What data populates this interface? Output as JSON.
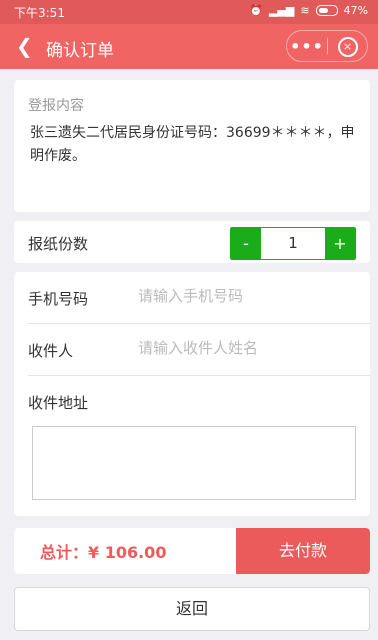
{
  "status_bar": {
    "time": "下午3:51",
    "battery": "47%"
  },
  "nav": {
    "title": "确认订单",
    "more_label": "•••",
    "close_label": "×"
  },
  "content": {
    "label": "登报内容",
    "text": "张三遗失二代居民身份证号码：36699＊＊＊＊，申明作废。"
  },
  "quantity": {
    "label": "报纸份数",
    "minus": "-",
    "value": "1",
    "plus": "+"
  },
  "form": {
    "phone_label": "手机号码",
    "phone_placeholder": "请输入手机号码",
    "recipient_label": "收件人",
    "recipient_placeholder": "请输入收件人姓名",
    "address_label": "收件地址"
  },
  "footer": {
    "total": "总计：¥ 106.00",
    "pay_label": "去付款",
    "back_label": "返回"
  },
  "colors": {
    "brand": "#f06464",
    "accent_green": "#1aad19",
    "price": "#f05a5a"
  }
}
